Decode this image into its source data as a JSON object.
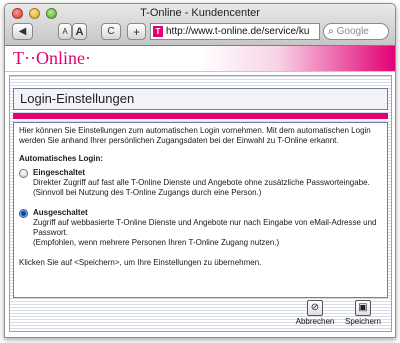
{
  "window": {
    "title": "T-Online - Kundencenter"
  },
  "toolbar": {
    "back_label": "◀",
    "font_small_label": "A",
    "font_large_label": "A",
    "reload_label": "C",
    "add_label": "+",
    "url": "http://www.t-online.de/service/ku",
    "search_placeholder": "Google"
  },
  "brand": {
    "logo_text": "T··Online·"
  },
  "section": {
    "title": "Login-Einstellungen"
  },
  "panel": {
    "intro": "Hier können Sie Einstellungen zum automatischen Login vornehmen. Mit dem automatischen Login werden Sie anhand Ihrer persönlichen Zugangsdaten bei der Einwahl zu T-Online erkannt.",
    "subhead": "Automatisches Login:",
    "options": [
      {
        "title": "Eingeschaltet",
        "line1": "Direkter Zugriff auf fast alle T-Online Dienste und Angebote ohne zusätzliche Passworteingabe.",
        "line2": "(Sinnvoll bei Nutzung des T-Online Zugangs durch eine Person.)",
        "checked": false
      },
      {
        "title": "Ausgeschaltet",
        "line1": "Zugriff auf webbasierte T-Online Dienste und Angebote nur nach Eingabe von eMail-Adresse und Passwort.",
        "line2": "(Empfohlen, wenn mehrere Personen Ihren T-Online Zugang nutzen.)",
        "checked": true
      }
    ],
    "footer": "Klicken Sie auf <Speichern>, um Ihre Einstellungen zu übernehmen."
  },
  "actions": {
    "cancel_label": "Abbrechen",
    "save_label": "Speichern"
  },
  "colors": {
    "accent": "#e20074",
    "radio_selected": "#2a5fb8"
  }
}
